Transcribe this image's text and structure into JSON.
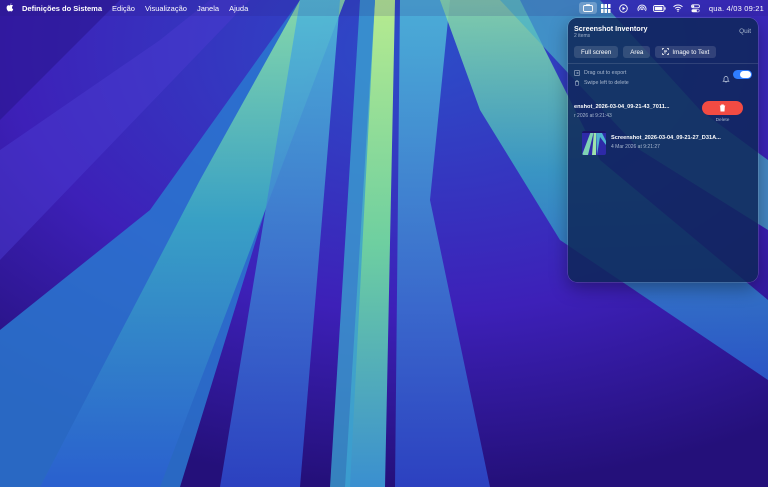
{
  "menubar": {
    "app_name": "Definições do Sistema",
    "menus": [
      "Edição",
      "Visualização",
      "Janela",
      "Ajuda"
    ],
    "status_icons": [
      "screenshot-inventory-icon",
      "grid-icon",
      "play-icon",
      "broadcast-icon",
      "battery-icon",
      "wifi-icon",
      "control-center-icon"
    ],
    "clock": "qua. 4/03  09:21"
  },
  "panel": {
    "title": "Screenshot Inventory",
    "subtitle": "2 items",
    "quit_label": "Quit",
    "buttons": {
      "full_screen": "Full screen",
      "area": "Area",
      "image_to_text": "Image to Text"
    },
    "hints": {
      "drag": "Drag out to export",
      "swipe": "Swipe left to delete"
    },
    "toggle_on": true,
    "items": [
      {
        "name": "enshot_2026-03-04_09-21-43_7011...",
        "date": "r 2026 at 9:21:43",
        "delete_label": "Delete"
      },
      {
        "name": "Screenshot_2026-03-04_09-21-27_D31A...",
        "date": "4 Mar 2026 at 9:21:27"
      }
    ]
  },
  "colors": {
    "accent": "#2f7dff",
    "delete": "#f24b43"
  }
}
